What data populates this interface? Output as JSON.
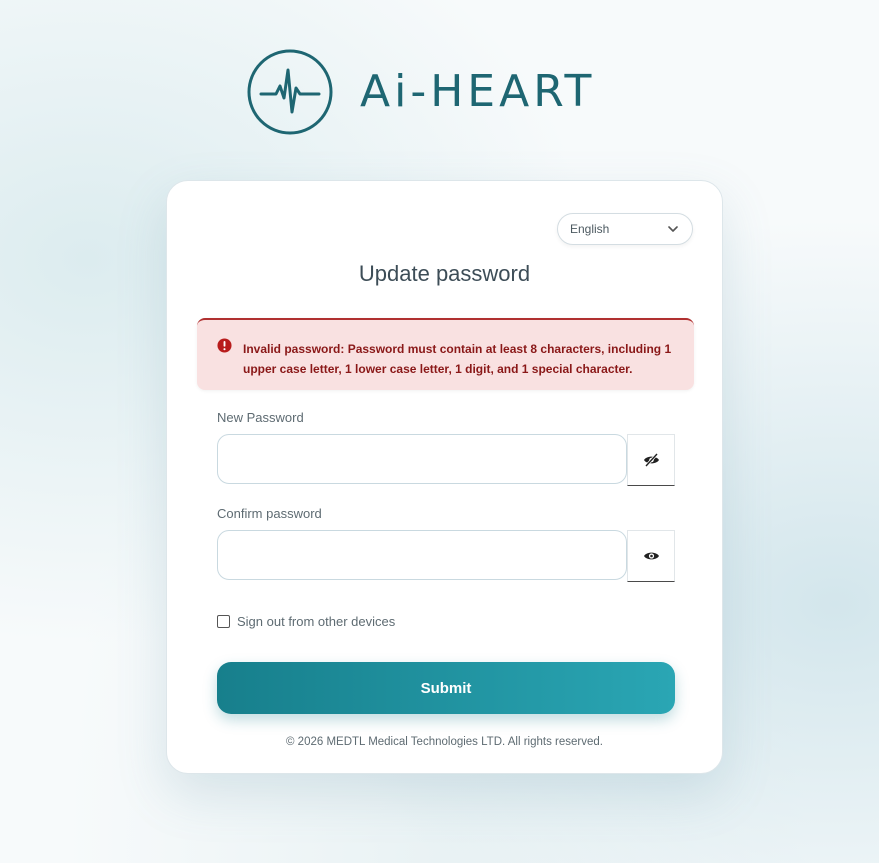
{
  "brand": {
    "name": "Ai-HEART",
    "primary_color": "#1e6672",
    "icon": "heartbeat-circle-icon"
  },
  "language": {
    "selected": "English",
    "icon": "chevron-down-icon"
  },
  "form": {
    "title": "Update password",
    "alert": {
      "icon": "error-circle-icon",
      "color": "#8a1818",
      "background": "#f9e1e1",
      "message": "Invalid password: Password must contain at least 8 characters, including 1 upper case letter, 1 lower case letter, 1 digit, and 1 special character."
    },
    "new_password": {
      "label": "New Password",
      "value": "",
      "toggle_icon": "eye-slash-icon"
    },
    "confirm_password": {
      "label": "Confirm password",
      "value": "",
      "toggle_icon": "eye-icon"
    },
    "sign_out_other_devices": {
      "label": "Sign out from other devices",
      "checked": false
    },
    "submit_label": "Submit",
    "submit_gradient": [
      "#177f8c",
      "#2aa6b4"
    ]
  },
  "footer": {
    "copyright": "© 2026 MEDTL Medical Technologies LTD. All rights reserved."
  }
}
